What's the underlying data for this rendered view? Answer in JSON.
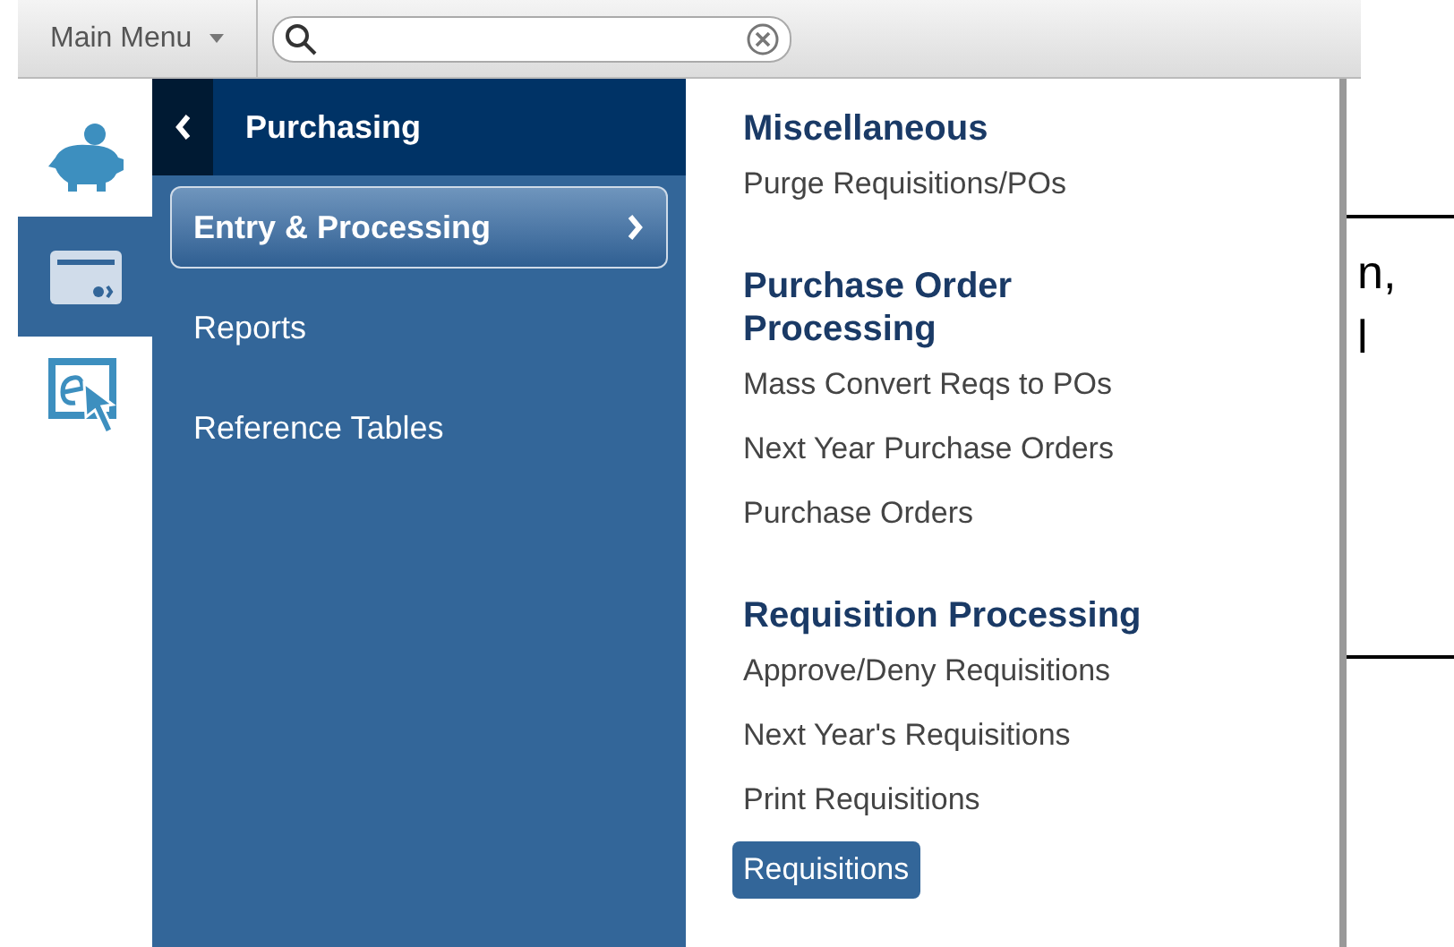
{
  "toolbar": {
    "menu_button": "Main Menu"
  },
  "rail": [
    {
      "kind": "piggy",
      "selected": false
    },
    {
      "kind": "card",
      "selected": true
    },
    {
      "kind": "epointer",
      "selected": false
    }
  ],
  "submenu": {
    "title": "Purchasing",
    "items": [
      {
        "label": "Entry & Processing",
        "selected": true
      },
      {
        "label": "Reports",
        "selected": false
      },
      {
        "label": "Reference Tables",
        "selected": false
      }
    ]
  },
  "sections": [
    {
      "heading": "Miscellaneous",
      "items": [
        {
          "label": "Purge Requisitions/POs",
          "selected": false
        }
      ]
    },
    {
      "heading": "Purchase Order Processing",
      "items": [
        {
          "label": "Mass Convert Reqs to POs",
          "selected": false
        },
        {
          "label": "Next Year Purchase Orders",
          "selected": false
        },
        {
          "label": "Purchase Orders",
          "selected": false
        }
      ]
    },
    {
      "heading": "Requisition Processing",
      "items": [
        {
          "label": "Approve/Deny Requisitions",
          "selected": false
        },
        {
          "label": "Next Year's Requisitions",
          "selected": false
        },
        {
          "label": "Print Requisitions",
          "selected": false
        },
        {
          "label": "Requisitions",
          "selected": true
        }
      ]
    }
  ],
  "background_fragments": [
    "n,",
    "l"
  ]
}
